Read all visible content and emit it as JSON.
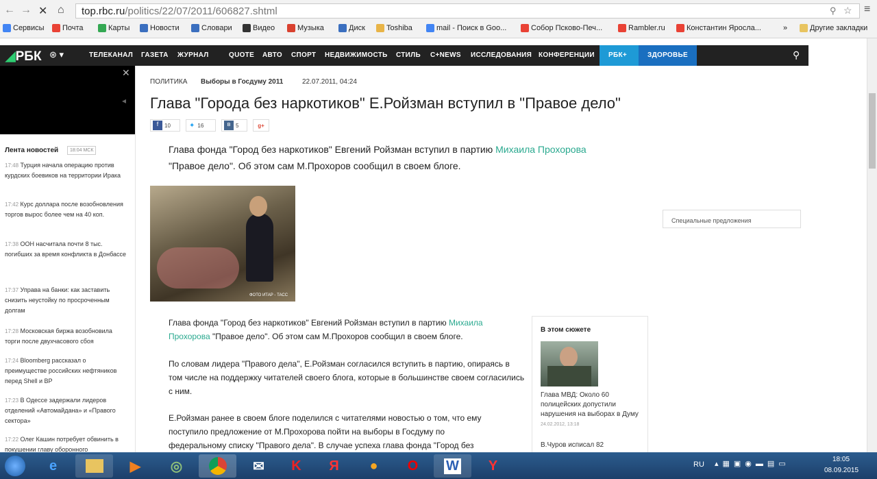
{
  "browser": {
    "url_host": "top.rbc.ru",
    "url_path": "/politics/22/07/2011/606827.shtml",
    "bookmarks": [
      {
        "label": "Сервисы",
        "color": "#4285f4"
      },
      {
        "label": "Почта",
        "color": "#e94235"
      },
      {
        "label": "Карты",
        "color": "#34a853"
      },
      {
        "label": "Новости",
        "color": "#3b6fbf"
      },
      {
        "label": "Словари",
        "color": "#3b6fbf"
      },
      {
        "label": "Видео",
        "color": "#333333"
      },
      {
        "label": "Музыка",
        "color": "#d9412f"
      },
      {
        "label": "Диск",
        "color": "#3b6fbf"
      },
      {
        "label": "Toshiba",
        "color": "#e8b447"
      },
      {
        "label": "mail - Поиск в Goo...",
        "color": "#4285f4"
      },
      {
        "label": "Собор Псково-Печ...",
        "color": "#e94235"
      },
      {
        "label": "Rambler.ru",
        "color": "#e94235"
      },
      {
        "label": "Константин Яросла...",
        "color": "#e94235"
      }
    ],
    "other_bookmarks": "Другие закладки"
  },
  "site": {
    "logo": "РБК",
    "nav": [
      "ТЕЛЕКАНАЛ",
      "ГАЗЕТА",
      "ЖУРНАЛ",
      "QUOTE",
      "АВТО",
      "СПОРТ",
      "НЕДВИЖИМОСТЬ",
      "СТИЛЬ",
      "C+NEWS",
      "ИССЛЕДОВАНИЯ",
      "КОНФЕРЕНЦИИ"
    ],
    "rbk_plus": "РБК+",
    "health": "ЗДОРОВЬЕ"
  },
  "feed": {
    "title": "Лента новостей",
    "time": "18:04 МСК",
    "items": [
      {
        "time": "17:48",
        "text": "Турция начала операцию против курдских боевиков на территории Ирака"
      },
      {
        "time": "17:42",
        "text": "Курс доллара после возобновления торгов вырос более чем на 40 коп."
      },
      {
        "time": "17:38",
        "text": "ООН насчитала почти 8 тыс. погибших за время конфликта в Донбассе"
      },
      {
        "time": "17:37",
        "text": "Управа на банки: как заставить снизить неустойку по просроченным долгам"
      },
      {
        "time": "17:28",
        "text": "Московская биржа возобновила торги после двухчасового сбоя"
      },
      {
        "time": "17:24",
        "text": "Bloomberg рассказал о преимуществе российских нефтяников перед Shell и BP"
      },
      {
        "time": "17:23",
        "text": "В Одессе задержали лидеров отделений «Автомайдана» и «Правого сектора»"
      },
      {
        "time": "17:22",
        "text": "Олег Кашин потребует обвинить в покушении главу оборонного"
      }
    ]
  },
  "article": {
    "rubric": "ПОЛИТИКА",
    "story": "Выборы в Госдуму 2011",
    "date": "22.07.2011, 04:24",
    "title": "Глава \"Города без наркотиков\" Е.Ройзман вступил в \"Правое дело\"",
    "shares": {
      "fb": "10",
      "tw": "16",
      "vk": "5",
      "gp": "g+"
    },
    "lead_a": "Глава фонда \"Город без наркотиков\" Евгений Ройзман вступил в партию ",
    "lead_link": "Михаила Прохорова",
    "lead_b": "\"Правое дело\". Об этом сам М.Прохоров сообщил в своем блоге.",
    "photo_credit": "ФОТО ИТАР - ТАСС",
    "p1_a": "Глава фонда \"Город без наркотиков\" Евгений Ройзман вступил в партию ",
    "p1_link1": "Михаила",
    "p1_link2": "Прохорова",
    "p1_b": " \"Правое дело\". Об этом сам М.Прохоров сообщил в своем блоге.",
    "p2": "По словам лидера \"Правого дела\", Е.Ройзман согласился вступить в партию, опираясь в том числе на поддержку читателей своего блога, которые в большинстве своем согласились с ним.",
    "p3": "Е.Ройзман ранее в своем блоге поделился с читателями новостью о том, что ему поступило предложение от М.Прохорова пойти на выборы в Госдуму по федеральному списку \"Правого дела\". В случае успеха глава фонда \"Город без"
  },
  "story_box": {
    "title": "В этом сюжете",
    "item1": "Глава МВД: Около 60 полицейских допустили нарушения на выборах в Думу",
    "item1_date": "24.02.2012, 13:18",
    "item2": "В.Чуров исписал 82"
  },
  "special": "Специальные предложения",
  "tray": {
    "lang": "RU",
    "time": "18:05",
    "date": "08.09.2015"
  }
}
